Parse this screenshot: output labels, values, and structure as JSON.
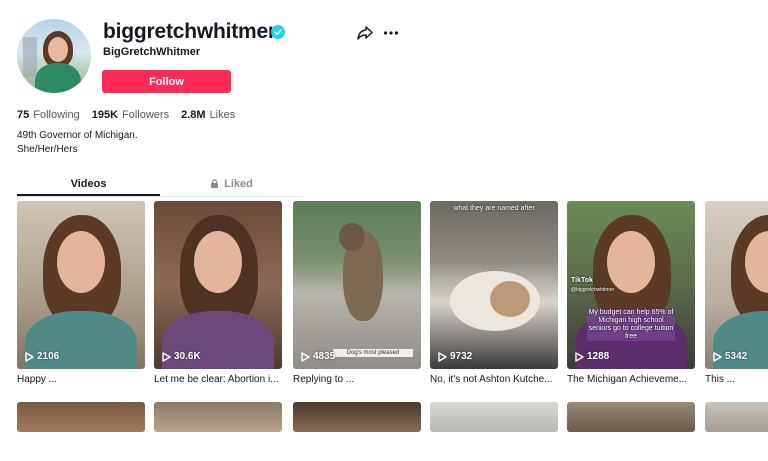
{
  "profile": {
    "username": "biggretchwhitmer",
    "nickname": "BigGretchWhitmer",
    "follow_label": "Follow",
    "bio": [
      "49th Governor of Michigan.",
      "She/Her/Hers"
    ]
  },
  "stats": [
    {
      "value": "75",
      "label": "Following"
    },
    {
      "value": "195K",
      "label": "Followers"
    },
    {
      "value": "2.8M",
      "label": "Likes"
    }
  ],
  "tabs": {
    "videos": "Videos",
    "liked": "Liked"
  },
  "videos": [
    {
      "views": "2106",
      "title": "Happy ...",
      "caption": ""
    },
    {
      "views": "30.6K",
      "title": "Let me be clear: Abortion i...",
      "caption": ""
    },
    {
      "views": "4835",
      "title": "Replying to ...",
      "caption": "Dog's most pleased"
    },
    {
      "views": "9732",
      "title": "No, it's not Ashton Kutche...",
      "caption": "what they are named after"
    },
    {
      "views": "1288",
      "title": "The Michigan Achieveme...",
      "caption": "My budget can help 65% of Michigan high school seniors go to college tuition free"
    },
    {
      "views": "5342",
      "title": "This ...",
      "caption": ""
    }
  ],
  "watermark": "TikTok",
  "watermark_handle": "@biggretchwhitmer",
  "colors": {
    "accent": "#fe2c55",
    "verified": "#20d5ec",
    "text": "#161823",
    "muted": "#8a8b91"
  },
  "icons": {
    "verified": "verified-check-icon",
    "share": "share-icon",
    "more": "more-dots-icon",
    "lock": "lock-icon",
    "play": "play-icon"
  }
}
